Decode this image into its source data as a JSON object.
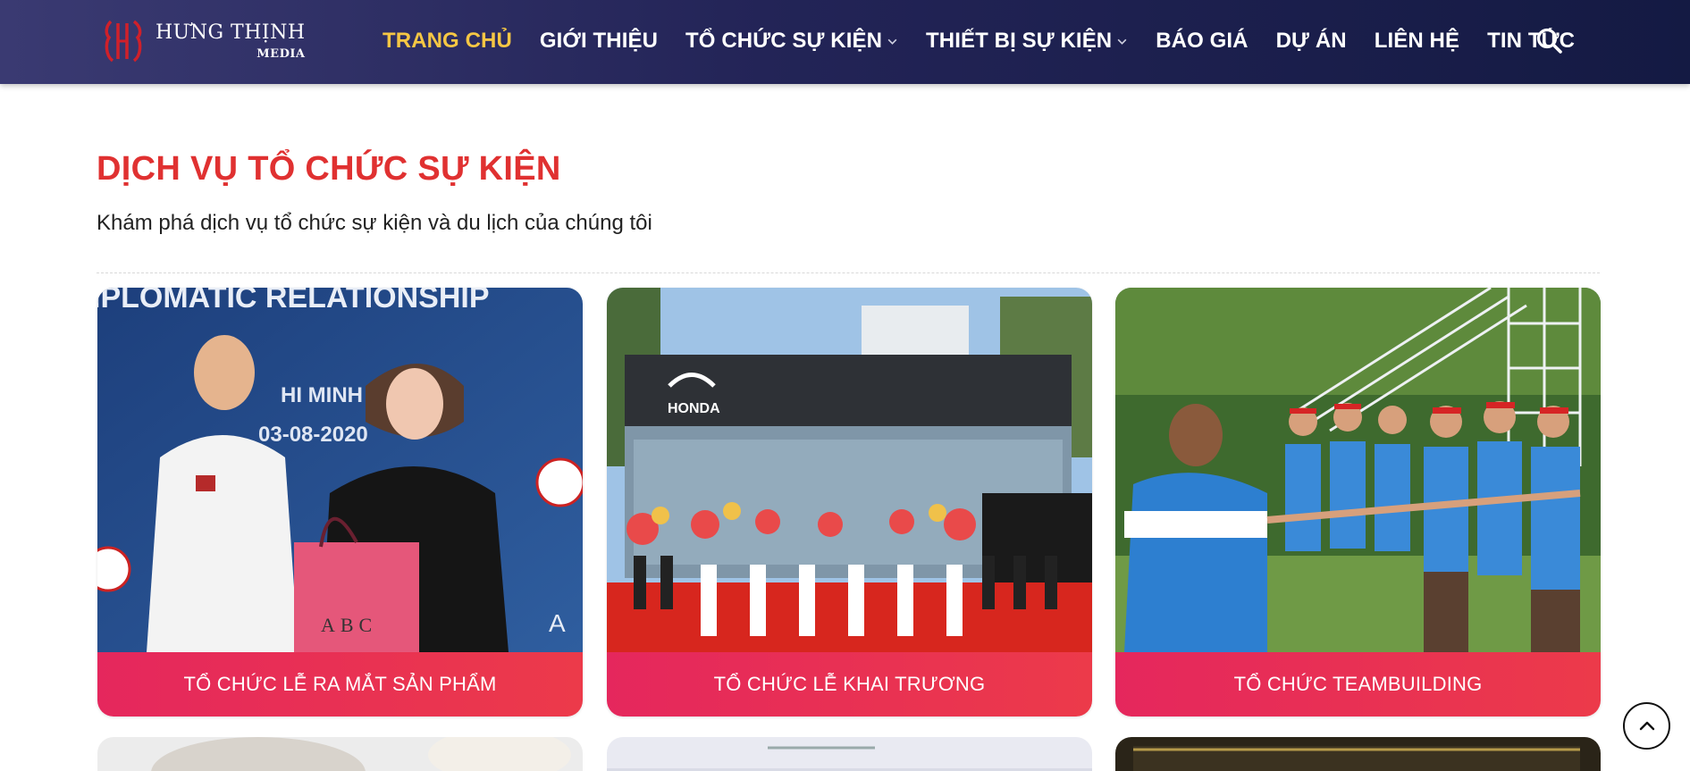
{
  "header": {
    "logo_name": "HƯNG THỊNH",
    "logo_sub": "MEDIA",
    "nav": [
      {
        "label": "TRANG CHỦ",
        "active": true
      },
      {
        "label": "GIỚI THIỆU"
      },
      {
        "label": "TỔ CHỨC SỰ KIỆN",
        "dropdown": true
      },
      {
        "label": "THIẾT BỊ SỰ KIỆN",
        "dropdown": true
      },
      {
        "label": "BÁO GIÁ"
      },
      {
        "label": "DỰ ÁN"
      },
      {
        "label": "LIÊN HỆ"
      },
      {
        "label": "TIN TỨC"
      }
    ],
    "search_icon": "search-icon"
  },
  "section": {
    "title": "DỊCH VỤ TỔ CHỨC SỰ KIỆN",
    "subtitle": "Khám phá dịch vụ tổ chức sự kiện và du lịch của chúng tôi"
  },
  "cards": [
    {
      "label": "TỔ CHỨC LỄ RA MẮT SẢN PHẨM"
    },
    {
      "label": "TỔ CHỨC LỄ KHAI TRƯƠNG"
    },
    {
      "label": "TỔ CHỨC TEAMBUILDING"
    }
  ],
  "photo_text": {
    "banner": "IPLOMATIC RELATIONSHIP",
    "city": "HI MINH CIT",
    "date": "03-08-2020",
    "bag": "ABC",
    "brand": "HONDA"
  },
  "colors": {
    "header_bg": "#232457",
    "nav_active": "#f6c744",
    "title": "#e03131",
    "card_label": "#e5275d"
  },
  "scroll_top_icon": "chevron-up-icon"
}
